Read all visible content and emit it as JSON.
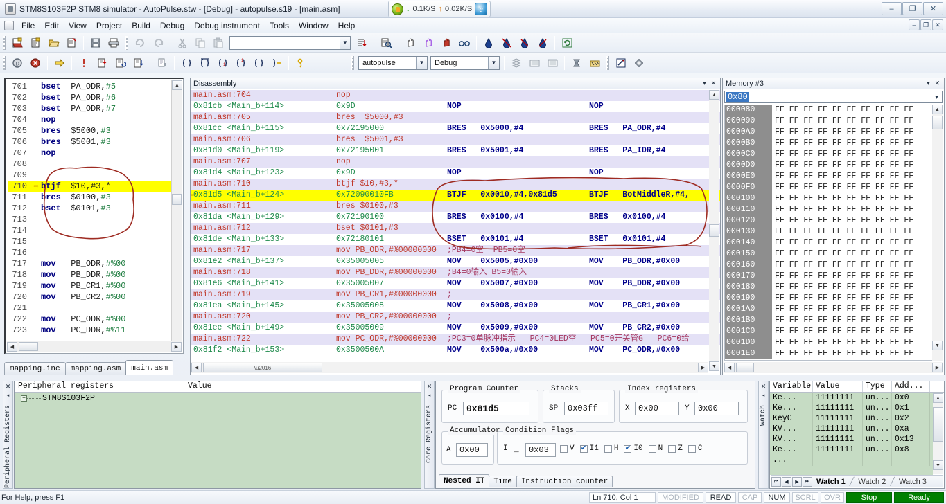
{
  "window": {
    "title": "STM8S103F2P STM8 simulator - AutoPulse.stw - [Debug] - autopulse.s19 - [main.asm]",
    "minimize": "–",
    "restore": "❐",
    "close": "✕",
    "mdi_minimize": "–",
    "mdi_restore": "❐",
    "mdi_close": "✕"
  },
  "net_widget": {
    "down_arrow": "↓",
    "down_rate": "0.1K/S",
    "up_arrow": "↑",
    "up_rate": "0.02K/S",
    "browser_glyph": "e"
  },
  "menu": {
    "items": [
      {
        "label": "File"
      },
      {
        "label": "Edit"
      },
      {
        "label": "View"
      },
      {
        "label": "Project"
      },
      {
        "label": "Build"
      },
      {
        "label": "Debug"
      },
      {
        "label": "Debug instrument"
      },
      {
        "label": "Tools"
      },
      {
        "label": "Window"
      },
      {
        "label": "Help"
      }
    ]
  },
  "toolbar1": {
    "buttons": [
      {
        "name": "new-workspace-icon",
        "glyph": "☰"
      },
      {
        "name": "new-file-icon",
        "glyph": "☰"
      },
      {
        "name": "open-file-icon",
        "glyph": "☰"
      },
      {
        "name": "close-file-icon",
        "glyph": "☰"
      },
      {
        "name": "save-icon",
        "glyph": "▤"
      },
      {
        "name": "print-icon",
        "glyph": "⎙"
      },
      {
        "name": "undo-icon",
        "glyph": "↶"
      },
      {
        "name": "redo-icon",
        "glyph": "↷"
      },
      {
        "name": "cut-icon",
        "glyph": "✂"
      },
      {
        "name": "copy-icon",
        "glyph": "❐"
      },
      {
        "name": "paste-icon",
        "glyph": "ὌB"
      }
    ],
    "find_combo_value": "",
    "find_combo_placeholder": "",
    "right_buttons": [
      {
        "name": "find-in-files-icon",
        "glyph": "⎘"
      },
      {
        "name": "binoculars-icon",
        "glyph": "⚲"
      },
      {
        "name": "hand-icon",
        "glyph": "✋"
      },
      {
        "name": "hand-stop-icon",
        "glyph": "✋"
      },
      {
        "name": "hand-red-icon",
        "glyph": "✋"
      },
      {
        "name": "glasses-icon",
        "glyph": "öö"
      },
      {
        "name": "fill-icon",
        "glyph": "◆"
      },
      {
        "name": "bookmark-toggle-icon",
        "glyph": "⚑"
      },
      {
        "name": "bookmark-next-icon",
        "glyph": "⚑"
      },
      {
        "name": "bookmark-clear-icon",
        "glyph": "⚑"
      },
      {
        "name": "refresh-icon",
        "glyph": "↻"
      }
    ]
  },
  "toolbar2": {
    "buttons": [
      {
        "name": "start-debug-icon",
        "glyph": "Ⓓ"
      },
      {
        "name": "stop-debug-icon",
        "glyph": "✖"
      },
      {
        "name": "continue-icon",
        "glyph": "⇨"
      },
      {
        "name": "halt-icon",
        "glyph": "!"
      },
      {
        "name": "step-into-icon",
        "glyph": "↴"
      },
      {
        "name": "step-over-icon",
        "glyph": "↷"
      },
      {
        "name": "step-out-icon",
        "glyph": "↵"
      },
      {
        "name": "run-to-cursor-icon",
        "glyph": "▤"
      },
      {
        "name": "open-brace-icon",
        "glyph": "{}"
      },
      {
        "name": "close-brace-icon",
        "glyph": "{}"
      },
      {
        "name": "brace-1-icon",
        "glyph": "{}"
      },
      {
        "name": "brace-2-icon",
        "glyph": "{}"
      },
      {
        "name": "brace-3-icon",
        "glyph": "{}"
      },
      {
        "name": "brace-4-icon",
        "glyph": "{}"
      },
      {
        "name": "breakpoint-icon",
        "glyph": "⚯"
      }
    ],
    "project_combo": "autopulse",
    "config_combo": "Debug",
    "right_buttons": [
      {
        "name": "build-icon",
        "glyph": "⬇"
      },
      {
        "name": "rebuild-icon",
        "glyph": "▒"
      },
      {
        "name": "batch-build-icon",
        "glyph": "▒"
      },
      {
        "name": "compile-icon",
        "glyph": "⚒"
      },
      {
        "name": "settings-build-icon",
        "glyph": "⚙"
      },
      {
        "name": "magnify-tool-icon",
        "glyph": "⌕"
      },
      {
        "name": "configure-icon",
        "glyph": "⚙"
      }
    ]
  },
  "editor": {
    "lines": [
      {
        "num": "701",
        "marker": "",
        "op": "bset",
        "arg": "PA_ODR,",
        "imm": "#5",
        "hl": false
      },
      {
        "num": "702",
        "marker": "",
        "op": "bset",
        "arg": "PA_ODR,",
        "imm": "#6",
        "hl": false
      },
      {
        "num": "703",
        "marker": "",
        "op": "bset",
        "arg": "PA_ODR,",
        "imm": "#7",
        "hl": false
      },
      {
        "num": "704",
        "marker": "",
        "op": "nop",
        "arg": "",
        "imm": "",
        "hl": false
      },
      {
        "num": "705",
        "marker": "",
        "op": "bres",
        "arg": "$5000,",
        "imm": "#3",
        "hl": false
      },
      {
        "num": "706",
        "marker": "",
        "op": "bres",
        "arg": "$5001,",
        "imm": "#3",
        "hl": false
      },
      {
        "num": "707",
        "marker": "",
        "op": "nop",
        "arg": "",
        "imm": "",
        "hl": false
      },
      {
        "num": "708",
        "marker": "",
        "op": "",
        "arg": "",
        "imm": "",
        "hl": false
      },
      {
        "num": "709",
        "marker": "",
        "op": "",
        "arg": "",
        "imm": "",
        "hl": false
      },
      {
        "num": "710",
        "marker": "⇨",
        "op": "btjf",
        "arg": "$10,#3,*",
        "imm": "",
        "hl": true
      },
      {
        "num": "711",
        "marker": "",
        "op": "bres",
        "arg": "$0100,",
        "imm": "#3",
        "hl": false
      },
      {
        "num": "712",
        "marker": "",
        "op": "bset",
        "arg": "$0101,",
        "imm": "#3",
        "hl": false
      },
      {
        "num": "713",
        "marker": "",
        "op": "",
        "arg": "",
        "imm": "",
        "hl": false
      },
      {
        "num": "714",
        "marker": "",
        "op": "",
        "arg": "",
        "imm": "",
        "hl": false
      },
      {
        "num": "715",
        "marker": "",
        "op": "",
        "arg": "",
        "imm": "",
        "hl": false
      },
      {
        "num": "716",
        "marker": "",
        "op": "",
        "arg": "",
        "imm": "",
        "hl": false
      },
      {
        "num": "717",
        "marker": "",
        "op": "mov",
        "arg": "PB_ODR,",
        "imm": "#%00",
        "hl": false
      },
      {
        "num": "718",
        "marker": "",
        "op": "mov",
        "arg": "PB_DDR,",
        "imm": "#%00",
        "hl": false
      },
      {
        "num": "719",
        "marker": "",
        "op": "mov",
        "arg": "PB_CR1,",
        "imm": "#%00",
        "hl": false
      },
      {
        "num": "720",
        "marker": "",
        "op": "mov",
        "arg": "PB_CR2,",
        "imm": "#%00",
        "hl": false
      },
      {
        "num": "721",
        "marker": "",
        "op": "",
        "arg": "",
        "imm": "",
        "hl": false
      },
      {
        "num": "722",
        "marker": "",
        "op": "mov",
        "arg": "PC_ODR,",
        "imm": "#%00",
        "hl": false
      },
      {
        "num": "723",
        "marker": "",
        "op": "mov",
        "arg": "PC_DDR,",
        "imm": "#%11",
        "hl": false
      }
    ],
    "tabs": [
      {
        "label": "mapping.inc",
        "active": false
      },
      {
        "label": "mapping.asm",
        "active": false
      },
      {
        "label": "main.asm",
        "active": true
      }
    ]
  },
  "disassembly": {
    "title": "Disassembly",
    "dropdown_glyph": "▾",
    "close_glyph": "✕",
    "lines": [
      {
        "type": "src",
        "a": "main.asm:704",
        "b": "nop",
        "c": "",
        "d": "",
        "hl": false,
        "pc": false
      },
      {
        "type": "code",
        "a": "0x81cb <Main_b+114>",
        "b": "0x9D",
        "c": "NOP",
        "d": "NOP",
        "hl": false,
        "pc": false
      },
      {
        "type": "src",
        "a": "main.asm:705",
        "b": "bres  $5000,#3",
        "c": "",
        "d": "",
        "hl": false,
        "pc": false
      },
      {
        "type": "code",
        "a": "0x81cc <Main_b+115>",
        "b": "0x72195000",
        "c": "BRES   0x5000,#4",
        "d": "BRES   PA_ODR,#4",
        "hl": false,
        "pc": false
      },
      {
        "type": "src",
        "a": "main.asm:706",
        "b": "bres  $5001,#3",
        "c": "",
        "d": "",
        "hl": false,
        "pc": false
      },
      {
        "type": "code",
        "a": "0x81d0 <Main_b+119>",
        "b": "0x72195001",
        "c": "BRES   0x5001,#4",
        "d": "BRES   PA_IDR,#4",
        "hl": false,
        "pc": false
      },
      {
        "type": "src",
        "a": "main.asm:707",
        "b": "nop",
        "c": "",
        "d": "",
        "hl": false,
        "pc": false
      },
      {
        "type": "code",
        "a": "0x81d4 <Main_b+123>",
        "b": "0x9D",
        "c": "NOP",
        "d": "NOP",
        "hl": false,
        "pc": false
      },
      {
        "type": "src",
        "a": "main.asm:710",
        "b": "btjf $10,#3,*",
        "c": "",
        "d": "",
        "hl": false,
        "pc": false
      },
      {
        "type": "code",
        "a": "0x81d5 <Main_b+124>",
        "b": "0x72090010FB",
        "c": "BTJF   0x0010,#4,0x81d5",
        "d": "BTJF   BotMiddleR,#4,",
        "hl": true,
        "pc": true
      },
      {
        "type": "src",
        "a": "main.asm:711",
        "b": "bres $0100,#3",
        "c": "",
        "d": "",
        "hl": false,
        "pc": false
      },
      {
        "type": "code",
        "a": "0x81da <Main_b+129>",
        "b": "0x72190100",
        "c": "BRES   0x0100,#4",
        "d": "BRES   0x0100,#4",
        "hl": false,
        "pc": false
      },
      {
        "type": "src",
        "a": "main.asm:712",
        "b": "bset $0101,#3",
        "c": "",
        "d": "",
        "hl": false,
        "pc": false
      },
      {
        "type": "code",
        "a": "0x81de <Main_b+133>",
        "b": "0x72180101",
        "c": "BSET   0x0101,#4",
        "d": "BSET   0x0101,#4",
        "hl": false,
        "pc": false
      },
      {
        "type": "src",
        "a": "main.asm:717",
        "b": "mov PB_ODR,#%00000000",
        "c": ";PB4=0空  PB5=0空",
        "d": "",
        "hl": false,
        "pc": false
      },
      {
        "type": "code",
        "a": "0x81e2 <Main_b+137>",
        "b": "0x35005005",
        "c": "MOV    0x5005,#0x00",
        "d": "MOV    PB_ODR,#0x00",
        "hl": false,
        "pc": false
      },
      {
        "type": "src",
        "a": "main.asm:718",
        "b": "mov PB_DDR,#%00000000",
        "c": ";B4=0输入 B5=0输入",
        "d": "",
        "hl": false,
        "pc": false
      },
      {
        "type": "code",
        "a": "0x81e6 <Main_b+141>",
        "b": "0x35005007",
        "c": "MOV    0x5007,#0x00",
        "d": "MOV    PB_DDR,#0x00",
        "hl": false,
        "pc": false
      },
      {
        "type": "src",
        "a": "main.asm:719",
        "b": "mov PB_CR1,#%00000000",
        "c": ";",
        "d": "",
        "hl": false,
        "pc": false
      },
      {
        "type": "code",
        "a": "0x81ea <Main_b+145>",
        "b": "0x35005008",
        "c": "MOV    0x5008,#0x00",
        "d": "MOV    PB_CR1,#0x00",
        "hl": false,
        "pc": false
      },
      {
        "type": "src",
        "a": "main.asm:720",
        "b": "mov PB_CR2,#%00000000",
        "c": ";",
        "d": "",
        "hl": false,
        "pc": false
      },
      {
        "type": "code",
        "a": "0x81ee <Main_b+149>",
        "b": "0x35005009",
        "c": "MOV    0x5009,#0x00",
        "d": "MOV    PB_CR2,#0x00",
        "hl": false,
        "pc": false
      },
      {
        "type": "src",
        "a": "main.asm:722",
        "b": "mov PC_ODR,#%00000000",
        "c": ";PC3=0单脉冲指示   PC4=0LED空   PC5=0开关管G   PC6=0给",
        "d": "",
        "hl": false,
        "pc": false
      },
      {
        "type": "code",
        "a": "0x81f2 <Main_b+153>",
        "b": "0x3500500A",
        "c": "MOV    0x500a,#0x00",
        "d": "MOV    PC_ODR,#0x00",
        "hl": false,
        "pc": false
      }
    ]
  },
  "memory": {
    "title": "Memory #3",
    "dropdown_glyph": "▾",
    "close_glyph": "✕",
    "address_value": "0x80",
    "address_dropdown_glyph": "▾",
    "cell_value": "FF",
    "columns": 10,
    "rows": [
      "000080",
      "000090",
      "0000A0",
      "0000B0",
      "0000C0",
      "0000D0",
      "0000E0",
      "0000F0",
      "000100",
      "000110",
      "000120",
      "000130",
      "000140",
      "000150",
      "000160",
      "000170",
      "000180",
      "000190",
      "0001A0",
      "0001B0",
      "0001C0",
      "0001D0",
      "0001E0"
    ]
  },
  "peripheral": {
    "vtab_label": "Peripheral Registers",
    "vtab_close": "✕",
    "vtab_pin": "◂",
    "col_name": "Peripheral registers",
    "col_value": "Value",
    "tree_expand": "+",
    "tree_node": "STM8S103F2P"
  },
  "core": {
    "vtab_label": "Core Registers",
    "vtab_close": "✕",
    "vtab_pin": "◂",
    "groups": {
      "program_counter": "Program Counter",
      "stacks": "Stacks",
      "index_registers": "Index registers",
      "accumulator": "Accumulator",
      "condition_flags": "Condition Flags"
    },
    "pc_label": "PC",
    "pc_value": "0x81d5",
    "sp_label": "SP",
    "sp_value": "0x03ff",
    "x_label": "X",
    "x_value": "0x00",
    "y_label": "Y",
    "y_value": "0x00",
    "a_label": "A",
    "a_value": "0x00",
    "cc_label": "I",
    "cc_label2": "_",
    "cc_value": "0x03",
    "flags": [
      {
        "label": "V",
        "checked": false
      },
      {
        "label": "I1",
        "checked": true
      },
      {
        "label": "H",
        "checked": false
      },
      {
        "label": "I0",
        "checked": true
      },
      {
        "label": "N",
        "checked": false
      },
      {
        "label": "Z",
        "checked": false
      },
      {
        "label": "C",
        "checked": false
      }
    ],
    "tabs": [
      {
        "label": "Nested IT",
        "active": true
      },
      {
        "label": "Time",
        "active": false
      },
      {
        "label": "Instruction counter",
        "active": false
      }
    ]
  },
  "watch": {
    "vtab_label": "Watch",
    "vtab_close": "✕",
    "vtab_pin": "◂",
    "headers": [
      "Variable",
      "Value",
      "Type",
      "Add..."
    ],
    "rows": [
      {
        "variable": "Ke...",
        "value": "11111111",
        "type": "un...",
        "address": "0x0"
      },
      {
        "variable": "Ke...",
        "value": "11111111",
        "type": "un...",
        "address": "0x1"
      },
      {
        "variable": "KeyC",
        "value": "11111111",
        "type": "un...",
        "address": "0x2"
      },
      {
        "variable": "KV...",
        "value": "11111111",
        "type": "un...",
        "address": "0xa"
      },
      {
        "variable": "KV...",
        "value": "11111111",
        "type": "un...",
        "address": "0x13"
      },
      {
        "variable": "Ke...",
        "value": "11111111",
        "type": "un...",
        "address": "0x8"
      },
      {
        "variable": "...",
        "value": "",
        "type": "",
        "address": ""
      }
    ],
    "nav": {
      "first": "⏮",
      "prev": "◀",
      "next": "▶",
      "last": "⏭"
    },
    "tabs": [
      {
        "label": "Watch 1",
        "active": true
      },
      {
        "label": "Watch 2",
        "active": false
      },
      {
        "label": "Watch 3",
        "active": false
      }
    ]
  },
  "statusbar": {
    "help": "For Help, press F1",
    "position": "Ln 710, Col 1",
    "modified": "MODIFIED",
    "read": "READ",
    "cap": "CAP",
    "num": "NUM",
    "scrl": "SCRL",
    "ovr": "OVR",
    "stop": "Stop",
    "ready": "Ready"
  },
  "colors": {
    "highlight": "#ffff00",
    "source_line_bg": "#e4e1f6",
    "green_panel": "#c6dcc4",
    "status_green": "#008000",
    "annotation_red": "#a02020"
  }
}
